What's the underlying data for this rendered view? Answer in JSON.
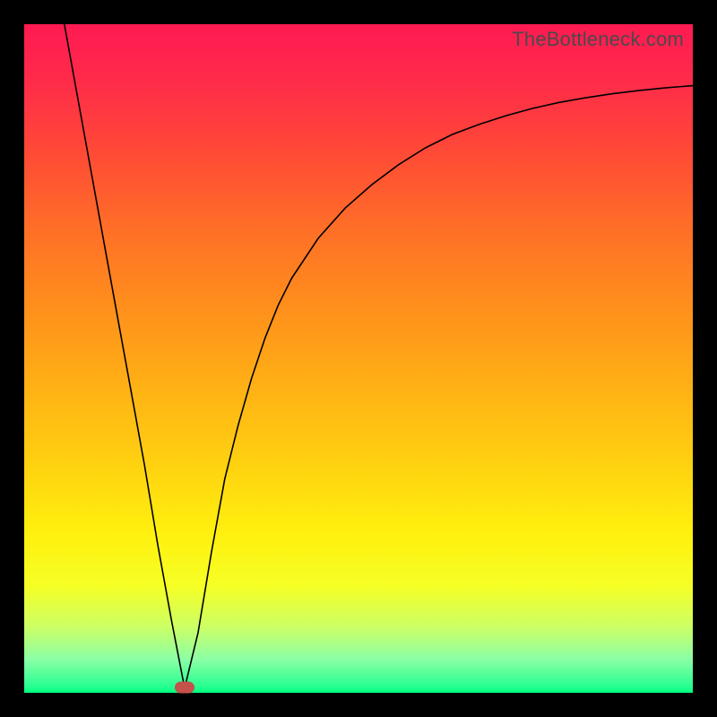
{
  "watermark": "TheBottleneck.com",
  "marker": {
    "x_pct": 24.0,
    "y_pct": 99.2
  },
  "chart_data": {
    "type": "line",
    "title": "",
    "xlabel": "",
    "ylabel": "",
    "xlim": [
      0,
      100
    ],
    "ylim": [
      0,
      100
    ],
    "x": [
      6,
      8,
      10,
      12,
      14,
      16,
      18,
      20,
      22,
      24,
      26,
      28,
      30,
      32,
      34,
      36,
      38,
      40,
      44,
      48,
      52,
      56,
      60,
      64,
      68,
      72,
      76,
      80,
      84,
      88,
      92,
      96,
      100
    ],
    "values": [
      0,
      11,
      22,
      33,
      44,
      55,
      66,
      78,
      89,
      99.3,
      91,
      79,
      68,
      60,
      53,
      47,
      42,
      38,
      32,
      27.5,
      24,
      21,
      18.5,
      16.5,
      15,
      13.7,
      12.6,
      11.7,
      11,
      10.4,
      9.9,
      9.5,
      9.2
    ],
    "series_note": "values are percentage from top (0 = top edge, 100 = bottom edge); visually a V dip at x≈24 then asymptotic rise"
  }
}
